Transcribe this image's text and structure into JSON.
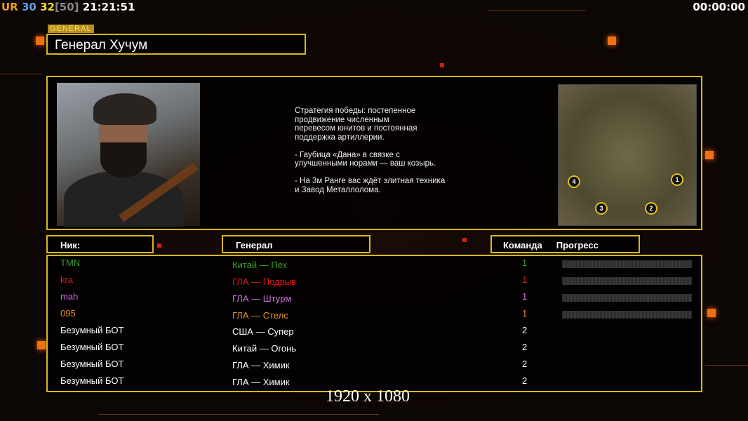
{
  "hud": {
    "ur": "UR",
    "n1": "30",
    "n2": "32",
    "cap": "[50]",
    "time": "21:21:51",
    "timer": "00:00:00"
  },
  "general": {
    "tag": "GENERAL",
    "name": "Генерал Хучум"
  },
  "description": "Стратегия победы: постепенное\nпродвижение численным\nперевесом юнитов и постоянная\nподдержка артиллерии.\n\n- Гаубица «Дана» в связке с\nулучшенными норами — ваш козырь.\n\n- На 3м Ранге вас ждёт элитная техника\nи Завод Металлолома.",
  "map": {
    "markers": [
      "1",
      "2",
      "3",
      "4"
    ]
  },
  "headers": {
    "nick": "Ник:",
    "general": "Генерал",
    "team": "Команда",
    "progress": "Прогресс"
  },
  "players": [
    {
      "nick": "TMN",
      "general": "Китай — Пех",
      "team": "1",
      "color": "#3aa02a",
      "progress": 0
    },
    {
      "nick": "kra",
      "general": "ГЛА — Подрыв",
      "team": "1",
      "color": "#e01a1a",
      "progress": 0
    },
    {
      "nick": "mah",
      "general": "ГЛА — Штурм",
      "team": "1",
      "color": "#d070e0",
      "progress": 0
    },
    {
      "nick": "095",
      "general": "ГЛА — Стелс",
      "team": "1",
      "color": "#e89020",
      "progress": 0
    },
    {
      "nick": "Безумный БОТ",
      "general": "США — Супер",
      "team": "2",
      "color": "#ffffff"
    },
    {
      "nick": "Безумный БОТ",
      "general": "Китай — Огонь",
      "team": "2",
      "color": "#ffffff"
    },
    {
      "nick": "Безумный БОТ",
      "general": "ГЛА — Химик",
      "team": "2",
      "color": "#ffffff"
    },
    {
      "nick": "Безумный БОТ",
      "general": "ГЛА — Химик",
      "team": "2",
      "color": "#ffffff"
    }
  ],
  "resolution": "1920 x 1080"
}
